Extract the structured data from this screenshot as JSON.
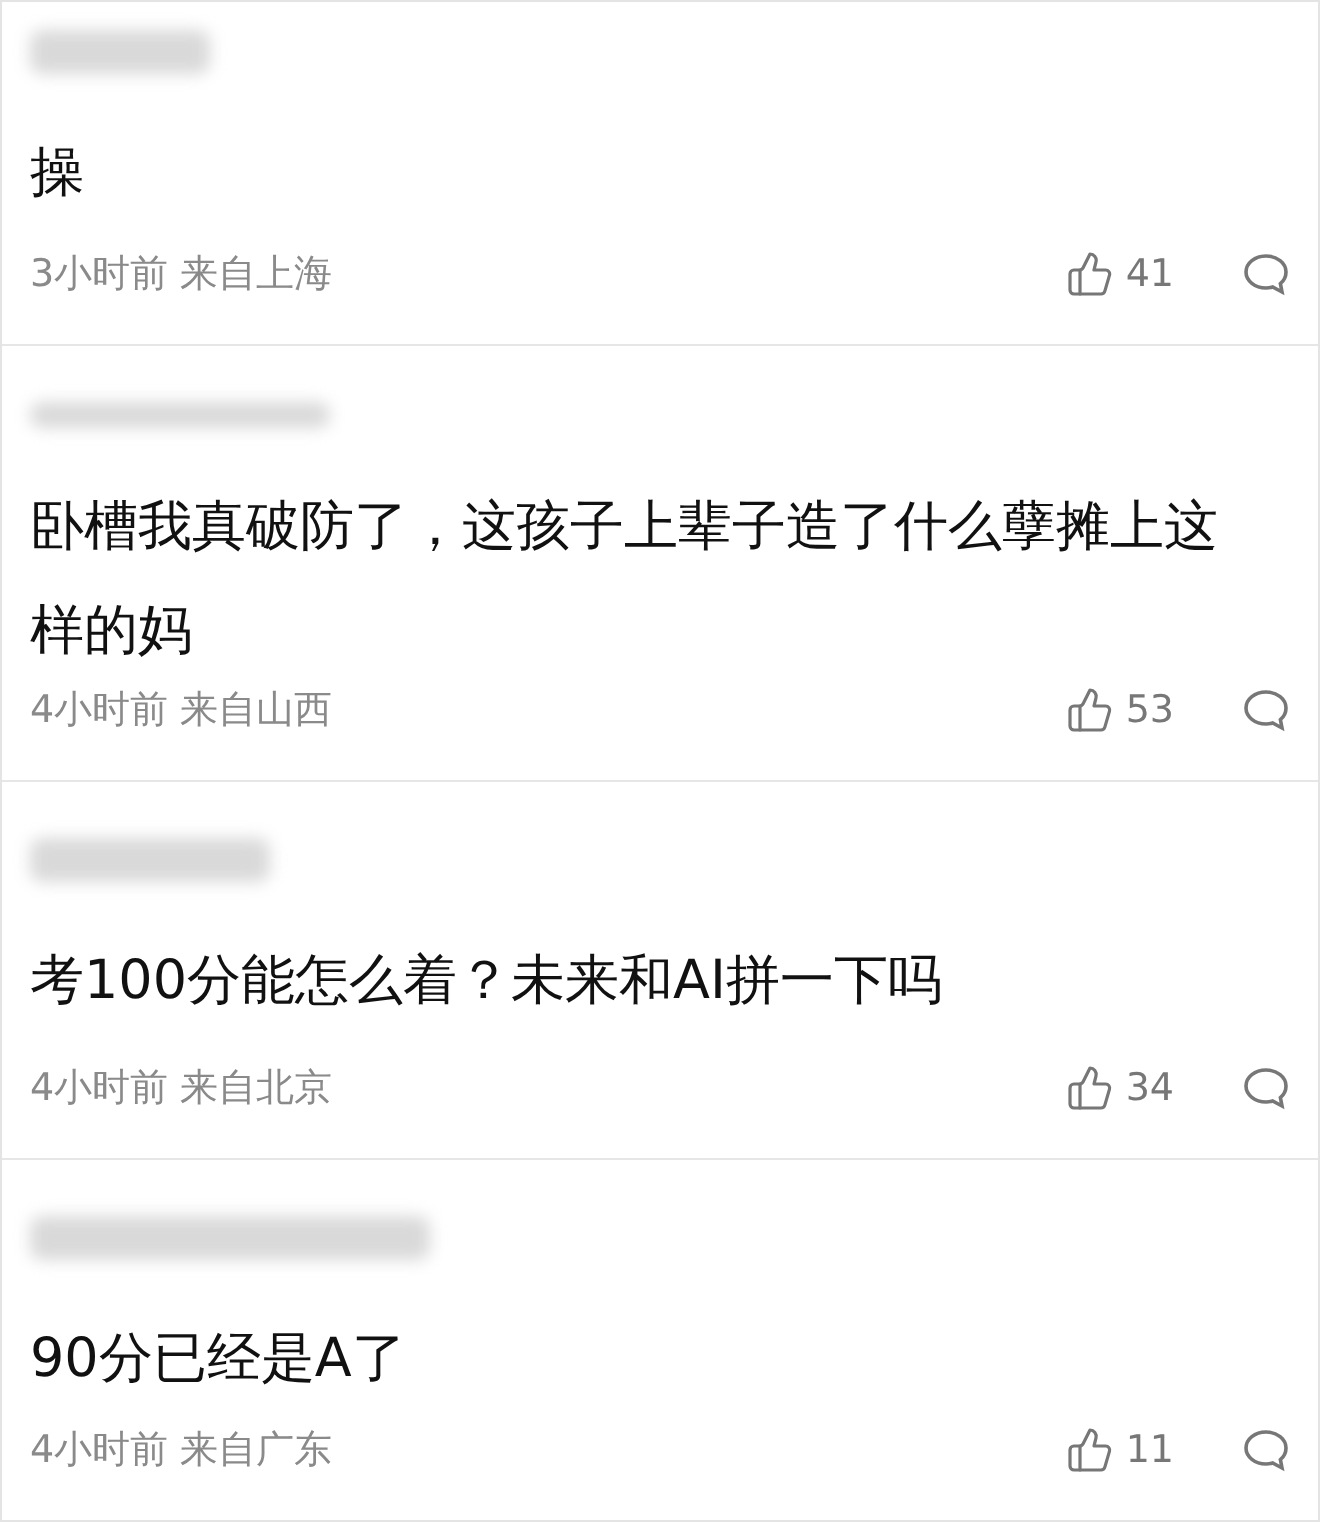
{
  "comments": [
    {
      "text": "操",
      "time": "3小时前",
      "location": "来自上海",
      "likes": "41"
    },
    {
      "text": "卧槽我真破防了，这孩子上辈子造了什么孽摊上这样的妈",
      "time": "4小时前",
      "location": "来自山西",
      "likes": "53"
    },
    {
      "text": "考100分能怎么着？未来和AI拼一下吗",
      "time": "4小时前",
      "location": "来自北京",
      "likes": "34"
    },
    {
      "text": "90分已经是A了",
      "time": "4小时前",
      "location": "来自广东",
      "likes": "11"
    }
  ]
}
